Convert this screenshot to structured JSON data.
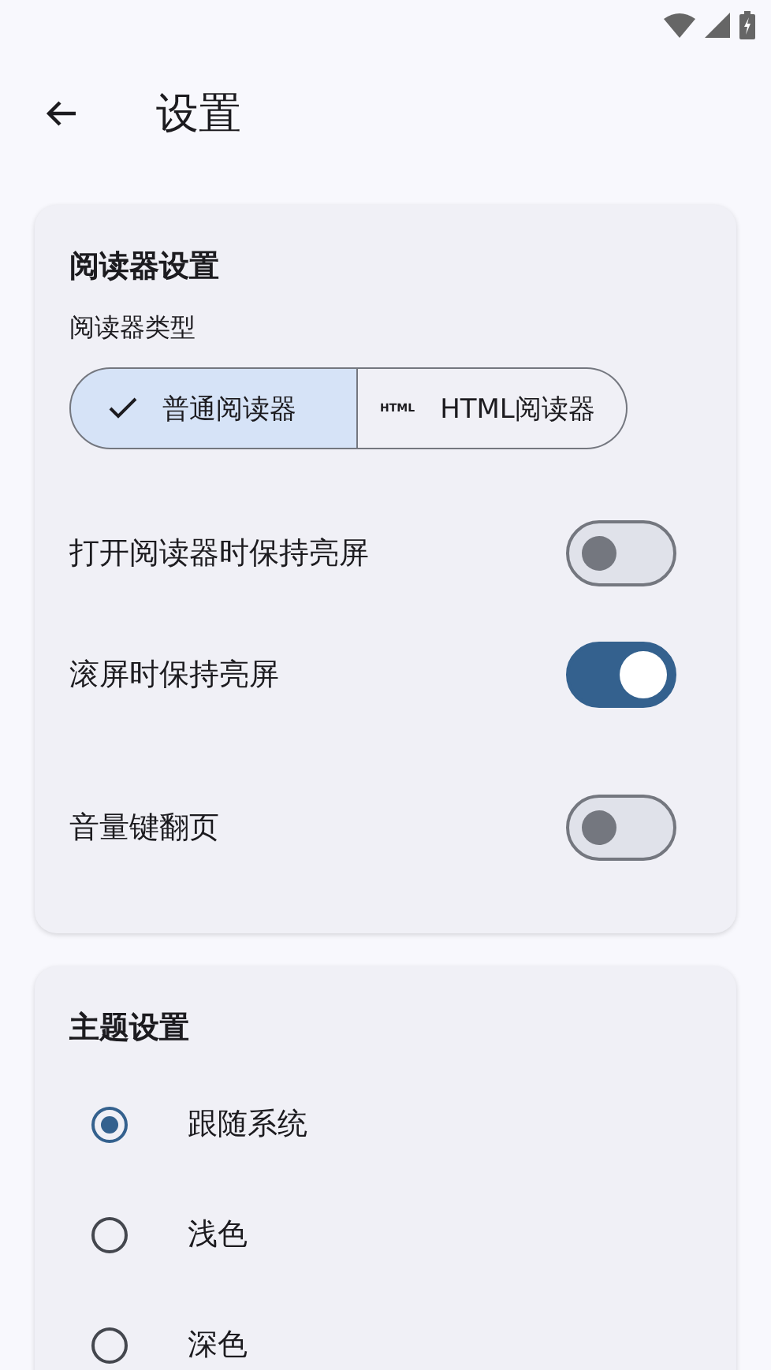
{
  "app_bar": {
    "title": "设置"
  },
  "reader_card": {
    "title": "阅读器设置",
    "subtitle": "阅读器类型",
    "reader_types": [
      {
        "label": "普通阅读器",
        "selected": true,
        "kind": "check"
      },
      {
        "label": "HTML阅读器",
        "selected": false,
        "kind": "html",
        "icon_text": "HTML"
      }
    ],
    "switches": [
      {
        "label": "打开阅读器时保持亮屏",
        "on": false
      },
      {
        "label": "滚屏时保持亮屏",
        "on": true
      },
      {
        "label": "音量键翻页",
        "on": false
      }
    ]
  },
  "theme_card": {
    "title": "主题设置",
    "options": [
      {
        "label": "跟随系统",
        "selected": true
      },
      {
        "label": "浅色",
        "selected": false
      },
      {
        "label": "深色",
        "selected": false
      }
    ]
  }
}
